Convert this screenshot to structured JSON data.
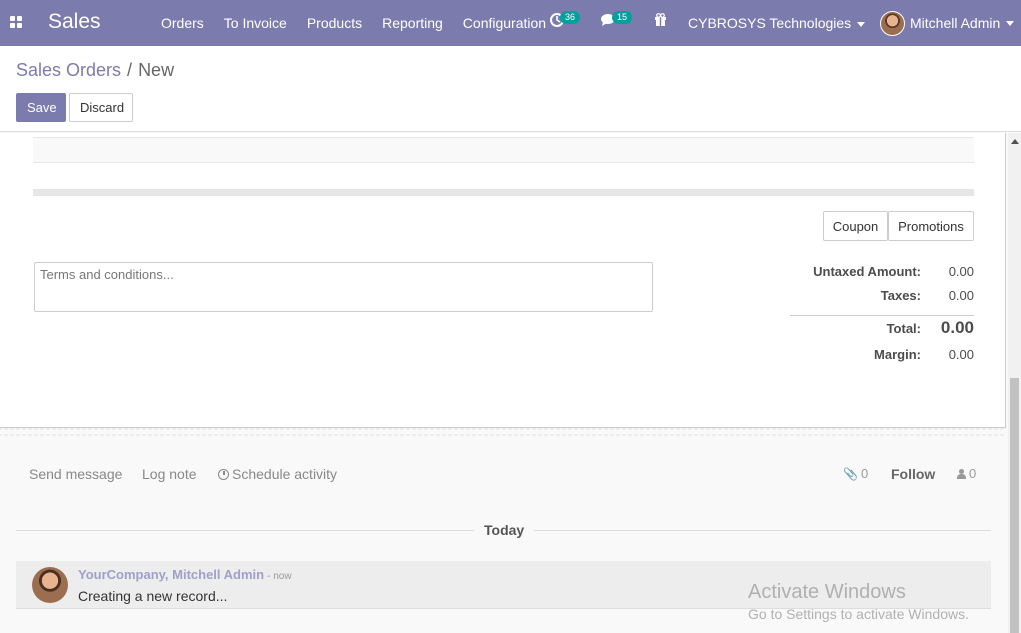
{
  "navbar": {
    "app_name": "Sales",
    "menu": [
      "Orders",
      "To Invoice",
      "Products",
      "Reporting",
      "Configuration"
    ],
    "activity_count": "36",
    "message_count": "15",
    "company": "CYBROSYS Technologies",
    "user": "Mitchell Admin",
    "bg_color": "#7c7bad"
  },
  "control_panel": {
    "breadcrumb_parent": "Sales Orders",
    "breadcrumb_separator": "/",
    "breadcrumb_current": "New",
    "save_label": "Save",
    "discard_label": "Discard"
  },
  "form": {
    "coupon_label": "Coupon",
    "promotions_label": "Promotions",
    "terms_placeholder": "Terms and conditions...",
    "totals": {
      "untaxed_label": "Untaxed Amount:",
      "untaxed_value": "0.00",
      "taxes_label": "Taxes:",
      "taxes_value": "0.00",
      "total_label": "Total:",
      "total_value": "0.00",
      "margin_label": "Margin:",
      "margin_value": "0.00"
    }
  },
  "chatter": {
    "send_message": "Send message",
    "log_note": "Log note",
    "schedule_activity": "Schedule activity",
    "attachment_count": "0",
    "follow_label": "Follow",
    "follower_count": "0",
    "today_label": "Today",
    "message": {
      "author": "YourCompany, Mitchell Admin",
      "time": "- now",
      "body": "Creating a new record..."
    }
  },
  "watermark": {
    "title": "Activate Windows",
    "subtitle": "Go to Settings to activate Windows."
  }
}
